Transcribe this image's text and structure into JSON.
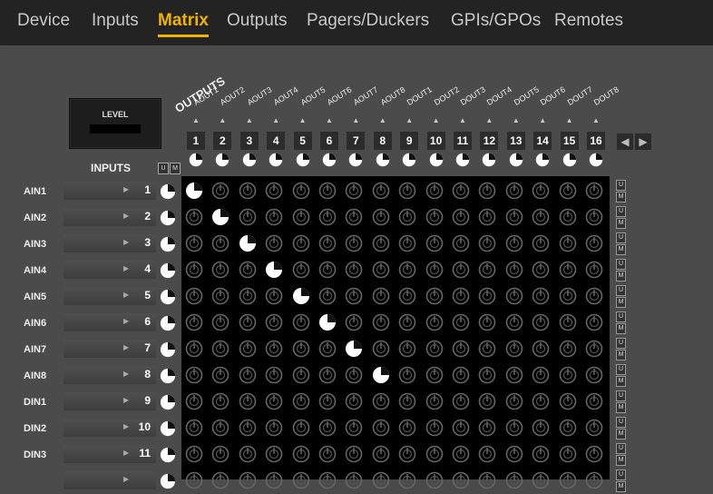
{
  "tabs": [
    "Device",
    "Inputs",
    "Matrix",
    "Outputs",
    "Pagers/Duckers",
    "GPIs/GPOs",
    "Remotes"
  ],
  "active_tab": "Matrix",
  "level_label": "LEVEL",
  "outputs_title": "OUTPUTS",
  "inputs_title": "INPUTS",
  "u_label": "U",
  "m_label": "M",
  "columns": [
    {
      "name": "AOUT1",
      "num": "1"
    },
    {
      "name": "AOUT2",
      "num": "2"
    },
    {
      "name": "AOUT3",
      "num": "3"
    },
    {
      "name": "AOUT4",
      "num": "4"
    },
    {
      "name": "AOUT5",
      "num": "5"
    },
    {
      "name": "AOUT6",
      "num": "6"
    },
    {
      "name": "AOUT7",
      "num": "7"
    },
    {
      "name": "AOUT8",
      "num": "8"
    },
    {
      "name": "DOUT1",
      "num": "9"
    },
    {
      "name": "DOUT2",
      "num": "10"
    },
    {
      "name": "DOUT3",
      "num": "11"
    },
    {
      "name": "DOUT4",
      "num": "12"
    },
    {
      "name": "DOUT5",
      "num": "13"
    },
    {
      "name": "DOUT6",
      "num": "14"
    },
    {
      "name": "DOUT7",
      "num": "15"
    },
    {
      "name": "DOUT8",
      "num": "16"
    }
  ],
  "rows": [
    {
      "name": "AIN1",
      "num": "1",
      "active": 1
    },
    {
      "name": "AIN2",
      "num": "2",
      "active": 2
    },
    {
      "name": "AIN3",
      "num": "3",
      "active": 3
    },
    {
      "name": "AIN4",
      "num": "4",
      "active": 4
    },
    {
      "name": "AIN5",
      "num": "5",
      "active": 5
    },
    {
      "name": "AIN6",
      "num": "6",
      "active": 6
    },
    {
      "name": "AIN7",
      "num": "7",
      "active": 7
    },
    {
      "name": "AIN8",
      "num": "8",
      "active": 8
    },
    {
      "name": "DIN1",
      "num": "9",
      "active": 0
    },
    {
      "name": "DIN2",
      "num": "10",
      "active": 0
    },
    {
      "name": "DIN3",
      "num": "11",
      "active": 0
    },
    {
      "name": "",
      "num": "",
      "active": 0
    }
  ],
  "colors": {
    "accent": "#f0b400",
    "grid_bg": "#000000",
    "panel": "#4b4b4b"
  },
  "icons": {
    "prev": "chevron-left-icon",
    "next": "chevron-right-icon"
  }
}
